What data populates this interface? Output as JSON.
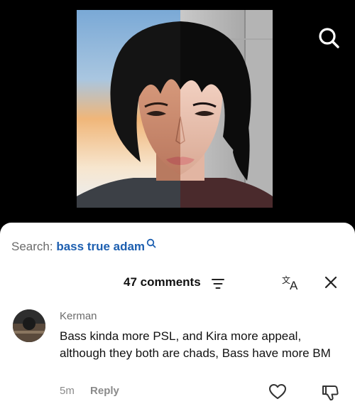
{
  "video": {
    "thumbnail_icon": "portrait-split-face-image"
  },
  "header": {
    "search_icon": "search-icon"
  },
  "search_suggestion": {
    "label": "Search:",
    "query": "bass true adam"
  },
  "comments_panel": {
    "count_label": "47 comments",
    "sort_icon": "sort-icon",
    "translate_icon": "translate-icon",
    "close_icon": "close-icon"
  },
  "comments": [
    {
      "username": "Kerman",
      "text": "Bass kinda more PSL, and Kira more appeal, although they both are chads, Bass have more BM",
      "time": "5m",
      "reply_label": "Reply"
    }
  ],
  "colors": {
    "background": "#000000",
    "sheet": "#ffffff",
    "link_blue": "#1d5fb0",
    "muted_text": "#6b6b6b"
  }
}
